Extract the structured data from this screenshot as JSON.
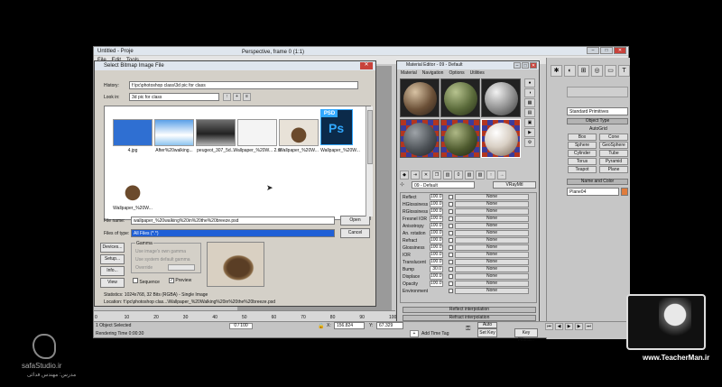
{
  "max": {
    "title": "Untitled - Proje",
    "menu": [
      "File",
      "Edit",
      "Tools"
    ],
    "viewport_title": "Perspective, frame 0 (1:1)"
  },
  "bitmap_dialog": {
    "title": "Select Bitmap Image File",
    "history_label": "History:",
    "history_value": "f:\\pc\\photoshop class\\3d pic for class",
    "lookin_label": "Look in:",
    "lookin_value": "3d pic for class",
    "files": [
      {
        "label": "4.jpg"
      },
      {
        "label": "After%20walking..."
      },
      {
        "label": "peugeot_307_5d..."
      },
      {
        "label": "Wallpaper_%20W... 2.tif"
      },
      {
        "label": "Wallpaper_%20W..."
      },
      {
        "label": "Wallpaper_%20W..."
      },
      {
        "label": "Wallpaper_%20W..."
      }
    ],
    "psd_badge": "PSD",
    "ps_badge": "Ps",
    "filename_label": "File name:",
    "filename_value": "wallpaper_%20walking%20in%20the%20breeze.psd",
    "filetype_label": "Files of type:",
    "filetype_value": "All Files (*.*)",
    "open_button": "Open",
    "cancel_button": "Cancel",
    "devices_button": "Devices...",
    "setup_button": "Setup...",
    "info_button": "Info...",
    "view_button": "View",
    "gamma_label": "Gamma",
    "gamma_opt1": "Use image's own gamma",
    "gamma_opt2": "Use system default gamma",
    "gamma_opt3": "Override",
    "sequence_label": "Sequence",
    "preview_label": "Preview",
    "statistics": "Statistics: 1024x768, 32 Bits (RGBA) - Single Image",
    "location": "Location: f:\\pc\\photoshop clas...\\Wallpaper_%20Walking%20in%20the%20breeze.psd"
  },
  "material_editor": {
    "title": "Material Editor - 09 - Default",
    "menu": [
      "Material",
      "Navigation",
      "Options",
      "Utilities"
    ],
    "material_name": "09 - Default",
    "material_type": "VRayMtl",
    "params": [
      {
        "label": "Reflect",
        "value": "100.0",
        "map": "None"
      },
      {
        "label": "HGlossiness",
        "value": "100.0",
        "map": "None"
      },
      {
        "label": "RGlossiness",
        "value": "100.0",
        "map": "None"
      },
      {
        "label": "Fresnel IOR",
        "value": "100.0",
        "map": "None"
      },
      {
        "label": "Anisotropy",
        "value": "100.0",
        "map": "None"
      },
      {
        "label": "An. rotation",
        "value": "100.0",
        "map": "None"
      },
      {
        "label": "Refract",
        "value": "100.0",
        "map": "None"
      },
      {
        "label": "Glossiness",
        "value": "100.0",
        "map": "None"
      },
      {
        "label": "IOR",
        "value": "100.0",
        "map": "None"
      },
      {
        "label": "Translucent",
        "value": "100.0",
        "map": "None"
      },
      {
        "label": "Bump",
        "value": "30.0",
        "map": "None"
      },
      {
        "label": "Displace",
        "value": "100.0",
        "map": "None"
      },
      {
        "label": "Opacity",
        "value": "100.0",
        "map": "None"
      },
      {
        "label": "Environment",
        "value": "",
        "map": "None"
      }
    ],
    "reflect_interp": "Reflect interpolation",
    "refract_interp": "Refract interpolation"
  },
  "command_panel": {
    "dropdown": "Standard Primitives",
    "object_type": "Object Type",
    "autogrid": "AutoGrid",
    "buttons": [
      "Box",
      "Cone",
      "Sphere",
      "GeoSphere",
      "Cylinder",
      "Tube",
      "Torus",
      "Pyramid",
      "Teapot",
      "Plane"
    ],
    "name_and_color": "Name and Color",
    "object_name": "Plane04"
  },
  "status": {
    "selected": "1 Object Selected",
    "rendering": "Rendering Time 0:00:30",
    "frame": "0 / 100",
    "x_value": "156.824",
    "y_value": "67.329",
    "add_time_tag": "Add Time Tag",
    "set_key": "Set Key",
    "key_filters": "Key Filters...",
    "auto": "Auto"
  },
  "timeline_ticks": [
    "0",
    "10",
    "20",
    "30",
    "40",
    "50",
    "60",
    "70",
    "80",
    "90",
    "100"
  ],
  "watermarks": {
    "left_site": "safaStudio.ir",
    "left_sub": "مدرس: مهندس فدائی",
    "right_site": "www.TeacherMan.ir"
  },
  "colors": {
    "accent_orange": "#e07c3c",
    "select_blue": "#1f5fd6",
    "close_red": "#c8423b"
  }
}
